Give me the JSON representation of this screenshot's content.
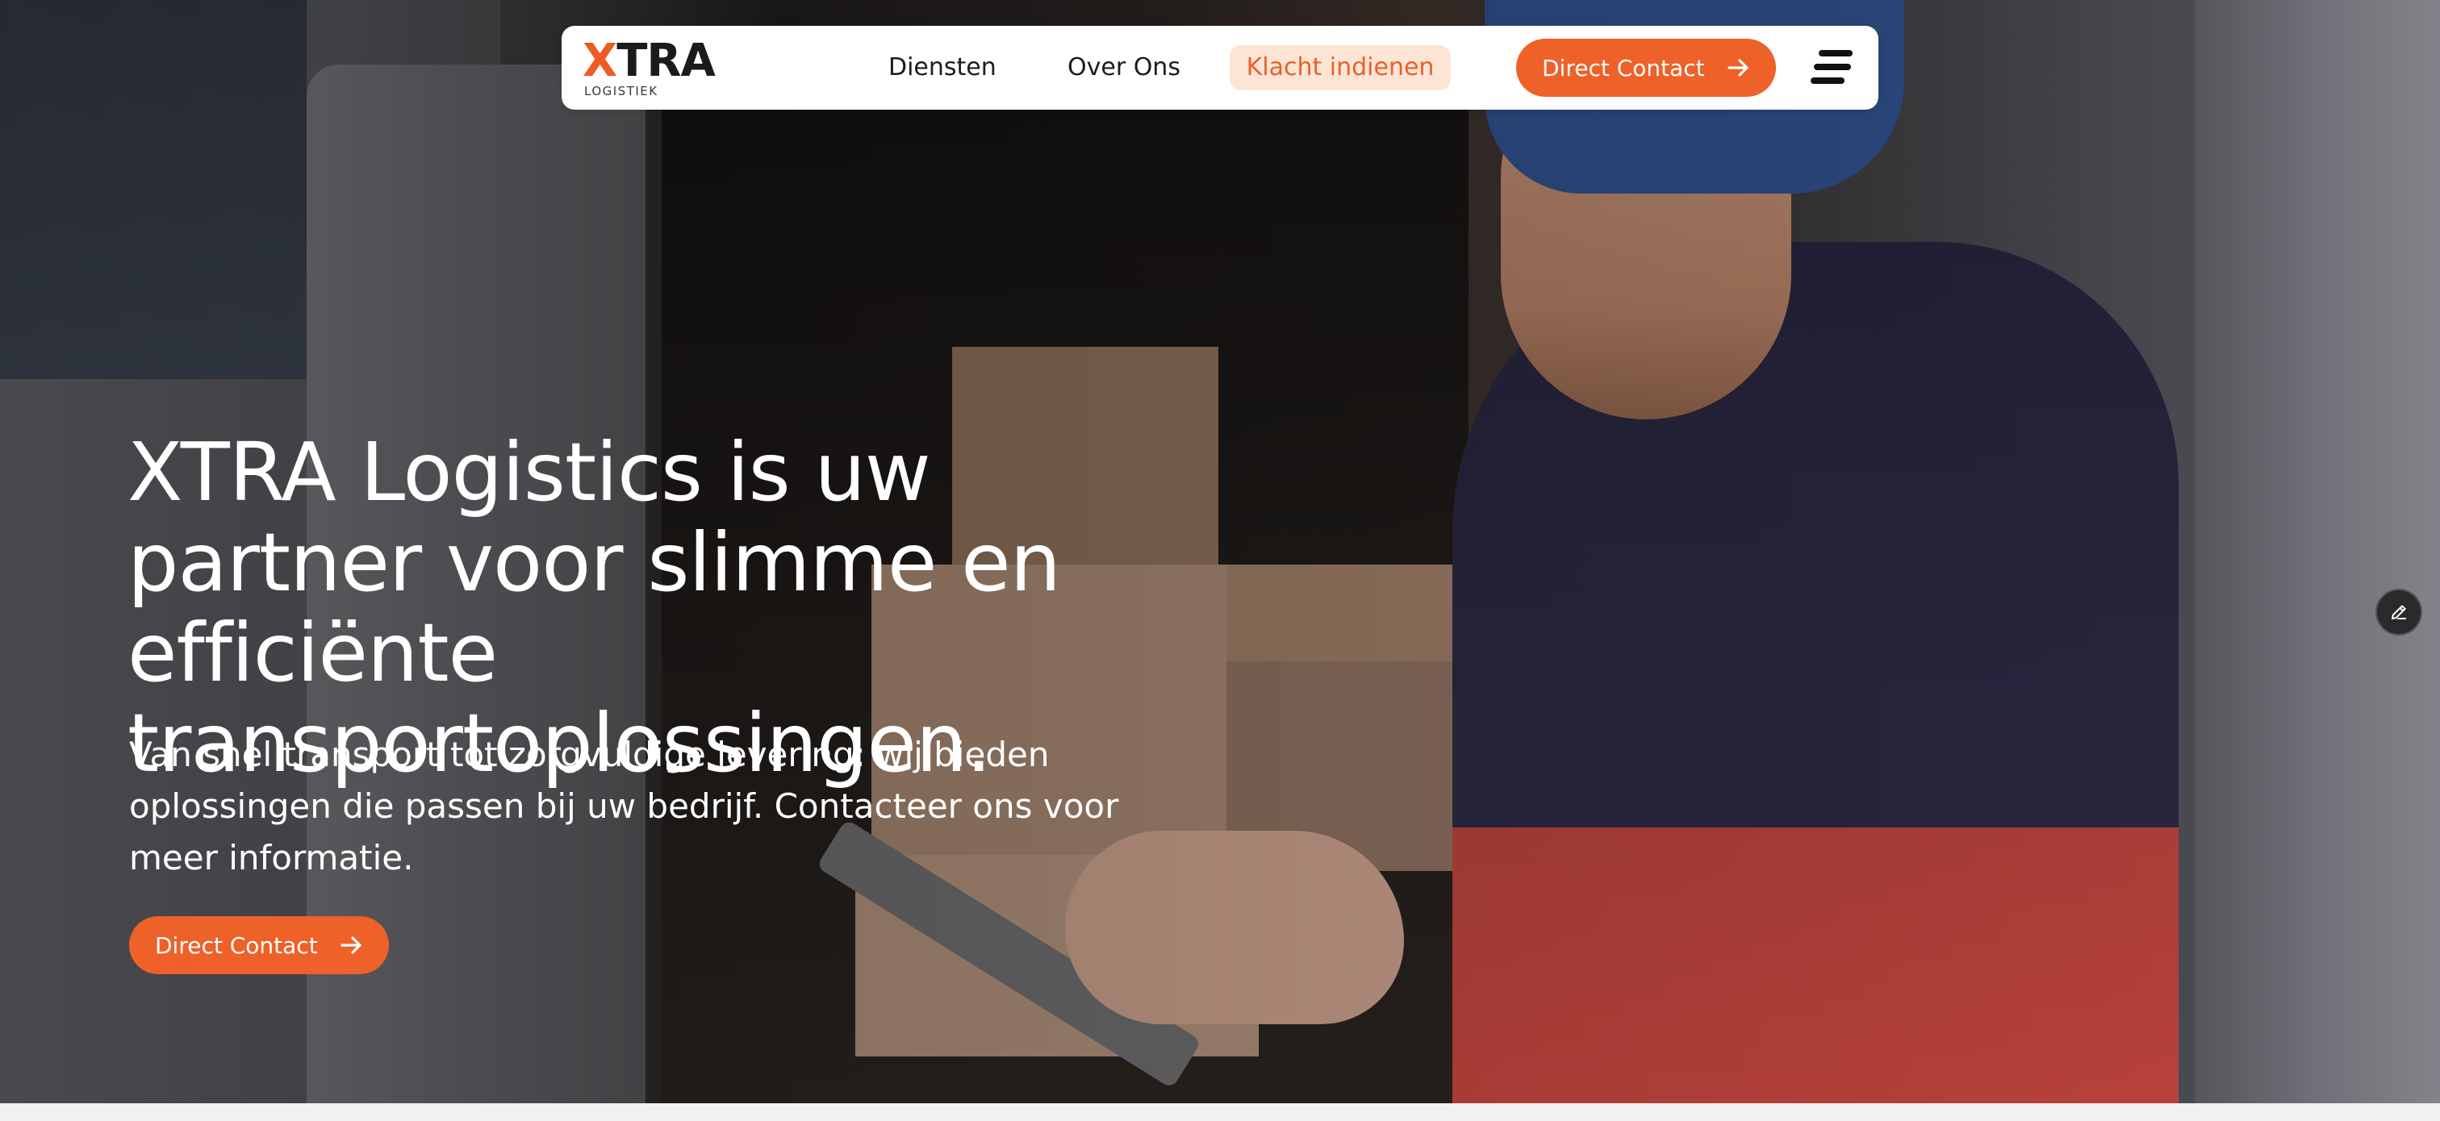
{
  "header": {
    "logo_text": "XTRA",
    "logo_subtext": "LOGISTIEK",
    "nav_items": [
      "Diensten",
      "Over Ons"
    ],
    "highlight_link": "Klacht indienen",
    "cta_label": "Direct Contact"
  },
  "hero": {
    "title": "XTRA Logistics is uw partner voor slimme en efficiënte transportoplossingen.",
    "subtitle": "Van snel transport tot zorgvuldige levering: wij bieden oplossingen die passen bij uw bedrijf. Contacteer ons voor meer informatie.",
    "cta_label": "Direct Contact"
  },
  "icons": {
    "cta_arrow": "arrow-right-icon",
    "menu": "hamburger-menu-icon",
    "edit": "pencil-icon"
  },
  "colors": {
    "accent": "#EE6128",
    "highlight_bg": "#FDE5D6",
    "highlight_text": "#E8612C",
    "nav_bg": "#FFFFFF"
  }
}
